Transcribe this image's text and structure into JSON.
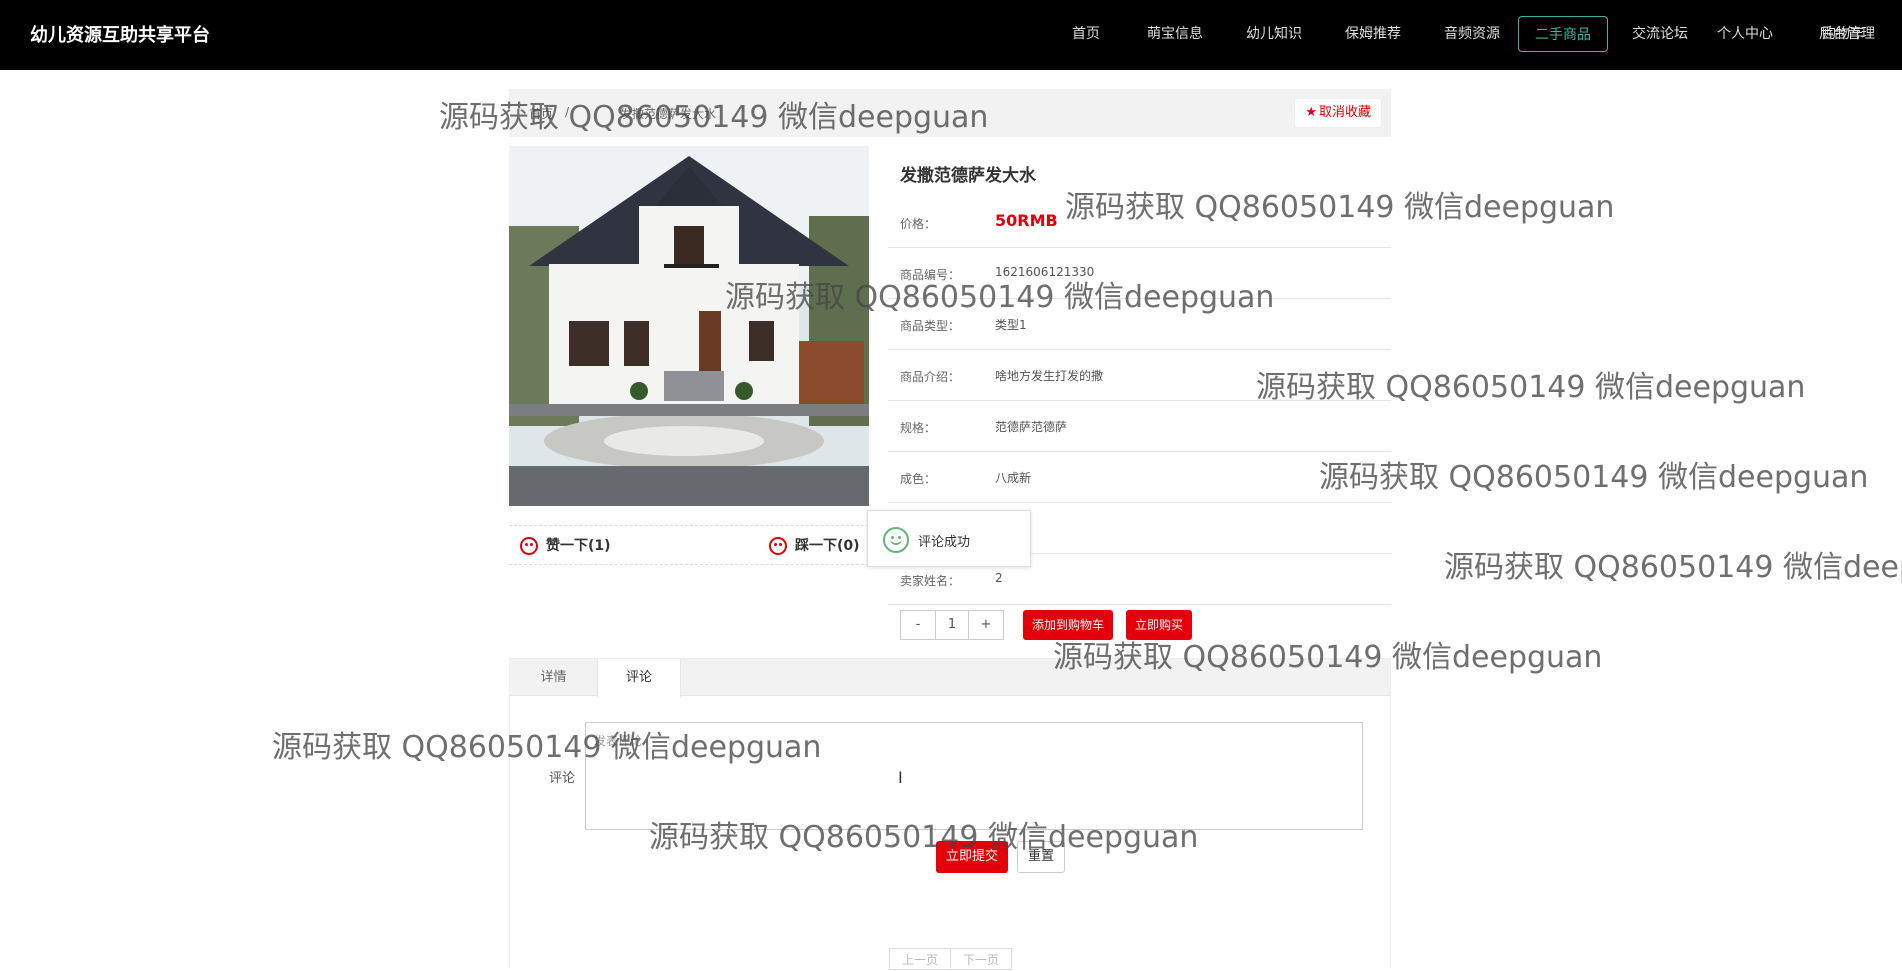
{
  "app": {
    "title": "幼儿资源互助共享平台"
  },
  "nav": {
    "items": [
      {
        "label": "首页"
      },
      {
        "label": "萌宝信息"
      },
      {
        "label": "幼儿知识"
      },
      {
        "label": "保姆推荐"
      },
      {
        "label": "音频资源"
      },
      {
        "label": "二手商品"
      },
      {
        "label": "交流论坛"
      },
      {
        "label": "个人中心"
      },
      {
        "label": "后台管理"
      },
      {
        "label": "购物车"
      }
    ],
    "active": "二手商品"
  },
  "breadcrumb": {
    "home": "首页",
    "current": "发撒范德萨发大水"
  },
  "favorite": {
    "label": "取消收藏",
    "icon": "star-icon"
  },
  "product": {
    "title": "发撒范德萨发大水",
    "image_alt": "house",
    "rows": [
      {
        "label": "价格：",
        "value": "50RMB"
      },
      {
        "label": "商品编号：",
        "value": "1621606121330"
      },
      {
        "label": "商品类型：",
        "value": "类型1"
      },
      {
        "label": "商品介绍：",
        "value": "啥地方发生打发的撒"
      },
      {
        "label": "规格：",
        "value": "范德萨范德萨"
      },
      {
        "label": "成色：",
        "value": "八成新"
      },
      {
        "label": "",
        "value": ""
      },
      {
        "label": "卖家姓名：",
        "value": "2"
      }
    ],
    "quantity": "1",
    "add_to_cart": "添加到购物车",
    "buy_now": "立即购买"
  },
  "votes": {
    "like": "赞一下(1)",
    "dislike": "踩一下(0)"
  },
  "toast": {
    "message": "评论成功"
  },
  "tabs": [
    {
      "label": "详情"
    },
    {
      "label": "评论"
    }
  ],
  "comment": {
    "label": "评论",
    "placeholder": "发表评论",
    "submit": "立即提交",
    "reset": "重置"
  },
  "pager": {
    "prev": "上一页",
    "next": "下一页"
  },
  "watermark": "源码获取 QQ86050149 微信deepguan",
  "colors": {
    "accent": "#e3000b",
    "nav_active": "#3bb3a5",
    "topbar": "#000000"
  }
}
